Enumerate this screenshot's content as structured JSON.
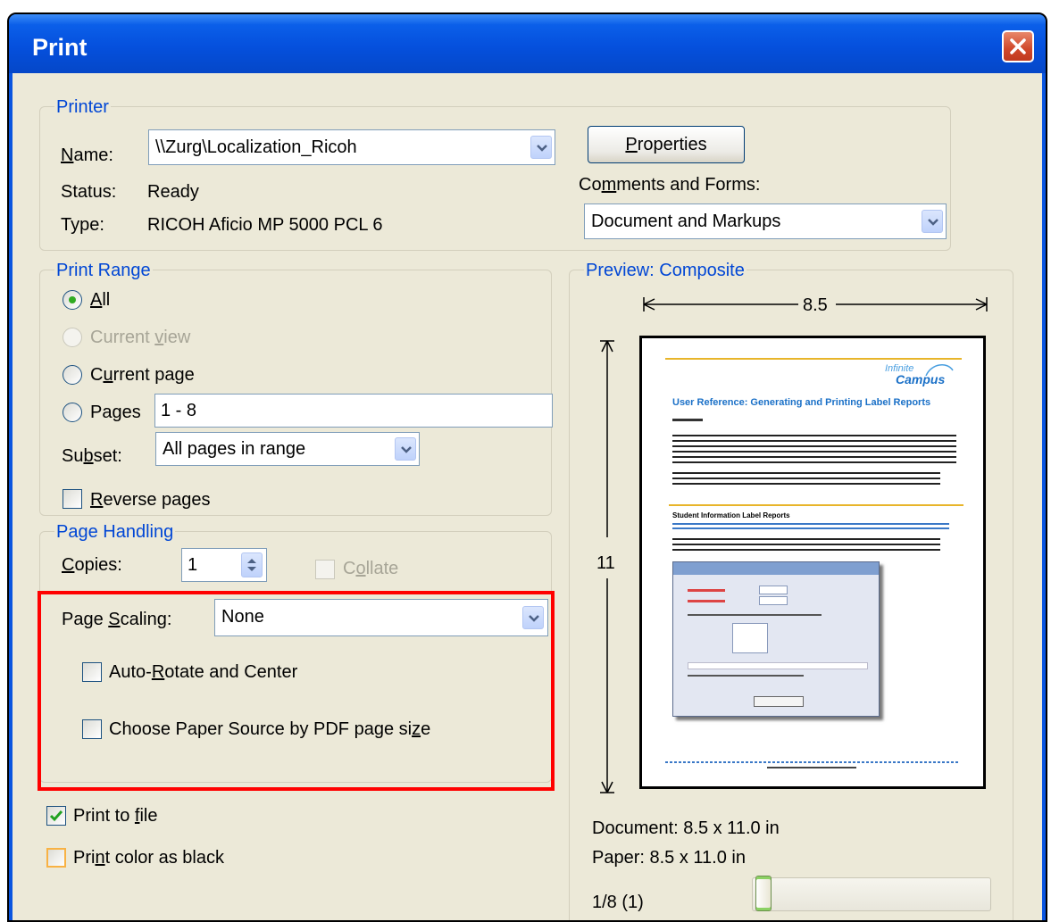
{
  "window": {
    "title": "Print"
  },
  "printer": {
    "legend": "Printer",
    "name_label": "Name:",
    "name_value": "\\\\Zurg\\Localization_Ricoh",
    "status_label": "Status:",
    "status_value": "Ready",
    "type_label": "Type:",
    "type_value": "RICOH Aficio MP 5000 PCL 6",
    "properties_label": "Properties",
    "comments_label": "Comments and Forms:",
    "comments_value": "Document and Markups"
  },
  "print_range": {
    "legend": "Print Range",
    "all_label": "All",
    "current_view_label": "Current view",
    "current_page_label": "Current page",
    "pages_label": "Pages",
    "pages_value": "1 - 8",
    "subset_label": "Subset:",
    "subset_value": "All pages in range",
    "reverse_label": "Reverse pages",
    "selected": "all"
  },
  "page_handling": {
    "legend": "Page Handling",
    "copies_label": "Copies:",
    "copies_value": "1",
    "collate_label": "Collate",
    "scaling_label": "Page Scaling:",
    "scaling_value": "None",
    "auto_rotate_label": "Auto-Rotate and Center",
    "paper_source_label": "Choose Paper Source by PDF page size",
    "highlight_color": "#ff0000"
  },
  "options": {
    "print_to_file_label": "Print to file",
    "print_to_file_checked": true,
    "print_color_black_label": "Print color as black"
  },
  "preview": {
    "legend": "Preview: Composite",
    "width_label": "8.5",
    "height_label": "11",
    "document_size": "Document: 8.5 x 11.0 in",
    "paper_size": "Paper: 8.5 x 11.0 in",
    "page_indicator": "1/8 (1)",
    "slider_fraction": 0.0,
    "thumb": {
      "logo_line1": "Infinite",
      "logo_line2": "Campus",
      "heading": "User Reference: Generating and Printing Label Reports",
      "section": "Student Information Label Reports"
    }
  }
}
